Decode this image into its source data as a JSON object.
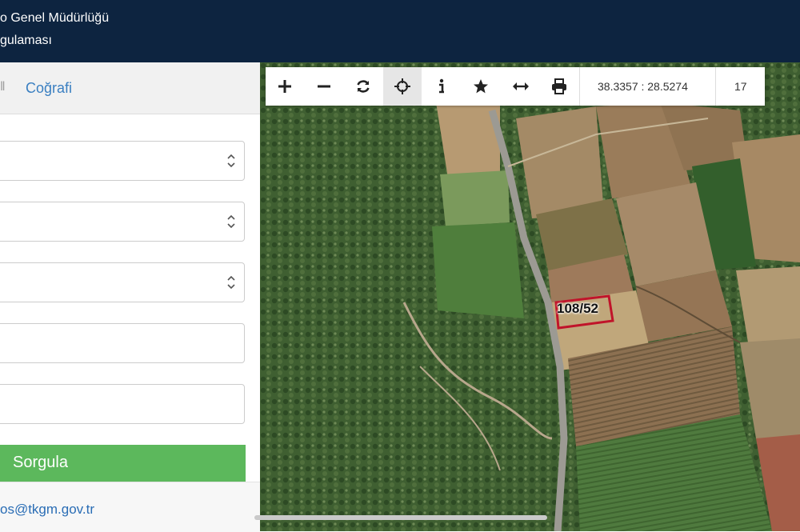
{
  "header": {
    "title_line1": "o Genel Müdürlüğü",
    "title_line2": "gulaması"
  },
  "sidebar": {
    "tab_separator": "ǁ",
    "tab_label": "Coğrafi",
    "query_button": "Sorgula",
    "contact_email": "os@tkgm.gov.tr"
  },
  "map": {
    "coordinates": "38.3357 : 28.5274",
    "zoom_level": "17",
    "parcel_label": "108/52",
    "parcel_color": "#c0142a",
    "tools": [
      "zoom-in-icon",
      "zoom-out-icon",
      "refresh-icon",
      "locate-icon",
      "info-icon",
      "favorite-star-icon",
      "measure-arrows-icon",
      "print-icon"
    ]
  },
  "colors": {
    "header_bg": "#0d2440",
    "link_blue": "#3a7fc1",
    "button_green": "#5cb85c"
  }
}
